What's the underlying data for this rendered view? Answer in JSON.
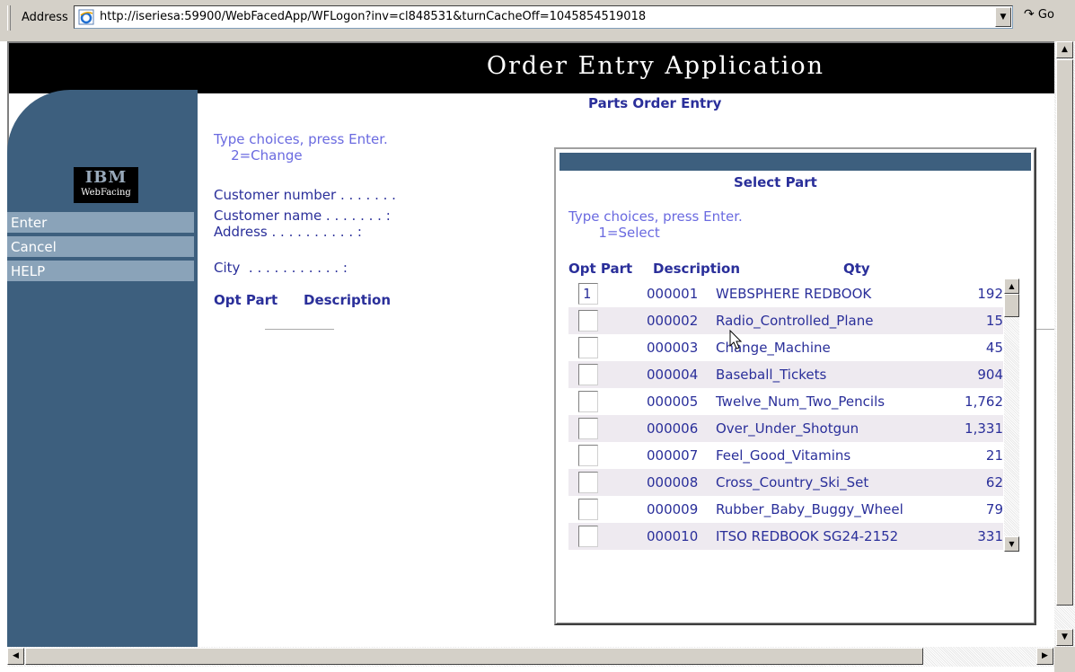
{
  "browser": {
    "address_label": "Address",
    "url": "http://iseriesa:59900/WebFacedApp/WFLogon?inv=cl848531&turnCacheOff=1045854519018",
    "go_label": "Go"
  },
  "banner": {
    "title": "Order Entry Application"
  },
  "sidebar": {
    "logo_top": "IBM",
    "logo_bottom": "WebFacing",
    "buttons": [
      "Enter",
      "Cancel",
      "HELP"
    ]
  },
  "main": {
    "title": "Parts Order Entry",
    "instr_line1": "Type choices, press Enter.",
    "instr_line2": "    2=Change",
    "customer_number": "Customer number . . . . . . .",
    "customer_name": "Customer name . . . . . . . :",
    "address": "Address . . . . . . . . . . :",
    "city": "City  . . . . . . . . . . . :",
    "hdr_opt_part": "Opt Part",
    "hdr_description": "Description"
  },
  "dialog": {
    "title": "Select Part",
    "instr_line1": "Type choices, press Enter.",
    "instr_line2": "       1=Select",
    "headers": {
      "opt_part": "Opt Part",
      "description": "Description",
      "qty": "Qty"
    },
    "rows": [
      {
        "opt": "1",
        "part": "000001",
        "description": "WEBSPHERE REDBOOK",
        "qty": "192"
      },
      {
        "opt": "",
        "part": "000002",
        "description": "Radio_Controlled_Plane",
        "qty": "15"
      },
      {
        "opt": "",
        "part": "000003",
        "description": "Change_Machine",
        "qty": "45"
      },
      {
        "opt": "",
        "part": "000004",
        "description": "Baseball_Tickets",
        "qty": "904"
      },
      {
        "opt": "",
        "part": "000005",
        "description": "Twelve_Num_Two_Pencils",
        "qty": "1,762"
      },
      {
        "opt": "",
        "part": "000006",
        "description": "Over_Under_Shotgun",
        "qty": "1,331"
      },
      {
        "opt": "",
        "part": "000007",
        "description": "Feel_Good_Vitamins",
        "qty": "21"
      },
      {
        "opt": "",
        "part": "000008",
        "description": "Cross_Country_Ski_Set",
        "qty": "62"
      },
      {
        "opt": "",
        "part": "000009",
        "description": "Rubber_Baby_Buggy_Wheel",
        "qty": "79"
      },
      {
        "opt": "",
        "part": "000010",
        "description": "ITSO REDBOOK SG24-2152",
        "qty": "331"
      }
    ]
  }
}
